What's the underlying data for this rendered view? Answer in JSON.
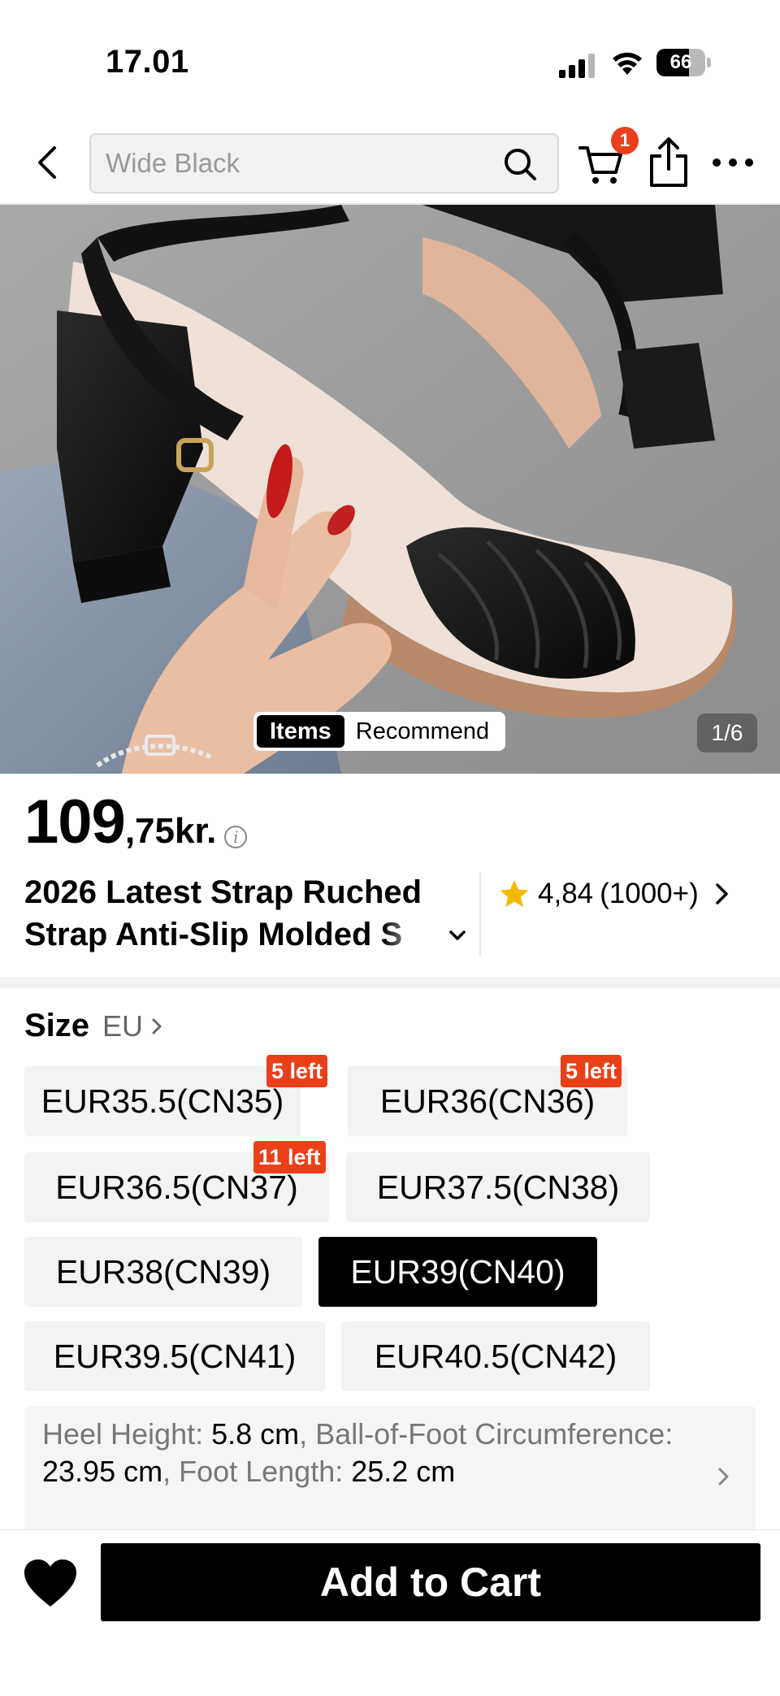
{
  "status_bar": {
    "time": "17.01",
    "battery": "66",
    "battery_level": 0.66
  },
  "nav": {
    "search_placeholder": "Wide Black",
    "cart_count": "1"
  },
  "image": {
    "toggle_items": "Items",
    "toggle_recommend": "Recommend",
    "counter": "1/6"
  },
  "product": {
    "price_int": "109",
    "price_dec": ",75kr.",
    "title_line1": "2026 Latest Strap Ruched",
    "title_line2": "Strap Anti-Slip Molded S",
    "rating_value": "4,84",
    "rating_count": "(1000+)"
  },
  "size": {
    "title": "Size",
    "unit": "EU",
    "options": [
      {
        "label": "EUR35.5(CN35)",
        "stock": "5 left"
      },
      {
        "label": "EUR36(CN36)",
        "stock": "5 left"
      },
      {
        "label": "EUR36.5(CN37)",
        "stock": "11 left"
      },
      {
        "label": "EUR37.5(CN38)",
        "stock": ""
      },
      {
        "label": "EUR38(CN39)",
        "stock": ""
      },
      {
        "label": "EUR39(CN40)",
        "stock": "",
        "selected": true
      },
      {
        "label": "EUR39.5(CN41)",
        "stock": ""
      },
      {
        "label": "EUR40.5(CN42)",
        "stock": ""
      }
    ]
  },
  "measurements": {
    "heel_label": "Heel Height: ",
    "heel_value": "5.8 cm",
    "sep1": ", Ball-of-Foot Circumference: ",
    "ball_value": "23.95 cm",
    "sep2": ", Foot Length: ",
    "foot_value": "25.2 cm"
  },
  "bottom": {
    "add_to_cart": "Add to Cart"
  },
  "colors": {
    "accent": "#e9401a",
    "badge": "#e8401c",
    "star": "#f5b800"
  }
}
